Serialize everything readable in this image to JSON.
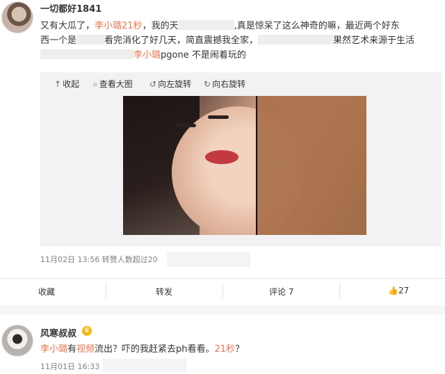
{
  "post": {
    "username": "一切都好1841",
    "text_l1_a": "又有大瓜了，",
    "text_l1_hl": "李小璐21秒",
    "text_l1_b": "，我的天",
    "text_l1_c": ",真是惊呆了这么神奇的嘛，最近两个好东",
    "text_l2_a": "西一个是",
    "text_l2_b": "看完消化了好几天，简直震撼我全家，",
    "text_l2_c": "果然艺术来源于生活",
    "text_l3_hl": "李小璐",
    "text_l3_b": "pgone 不是闹着玩的",
    "toolbar": {
      "collapse": "收起",
      "view_large": "查看大图",
      "rotate_left": "向左旋转",
      "rotate_right": "向右旋转"
    },
    "meta": "11月02日 13:56 转赞人数超过20"
  },
  "actions": {
    "favorite": "收藏",
    "repost": "转发",
    "comment": "评论 7",
    "like_count": "27"
  },
  "comment": {
    "username": "风寒叔叔",
    "text_hl1": "李小璐",
    "text_a": "有",
    "text_hl2": "视频",
    "text_b": "流出？吓的我赶紧去ph看看。",
    "text_hl3": "21秒",
    "text_c": "？",
    "meta": "11月01日 16:33"
  },
  "colors": {
    "highlight": "#eb7350"
  }
}
